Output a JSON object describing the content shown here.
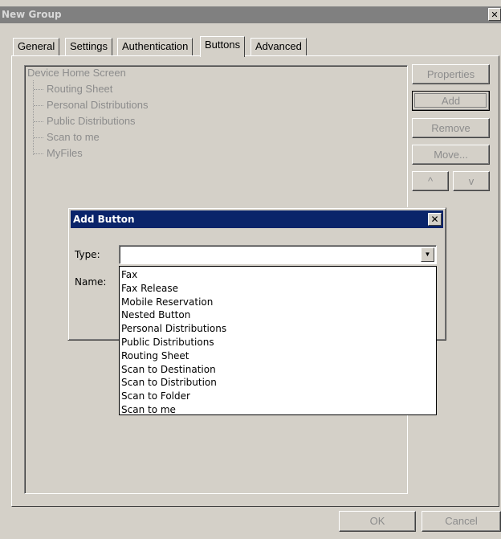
{
  "window": {
    "title": "New Group",
    "close_glyph": "✕"
  },
  "tabs": [
    {
      "label": "General"
    },
    {
      "label": "Settings"
    },
    {
      "label": "Authentication"
    },
    {
      "label": "Buttons",
      "active": true
    },
    {
      "label": "Advanced"
    }
  ],
  "tree": {
    "root": "Device Home Screen",
    "items": [
      "Routing Sheet",
      "Personal Distributions",
      "Public Distributions",
      "Scan to me",
      "MyFiles"
    ]
  },
  "side_buttons": {
    "properties": "Properties",
    "add": "Add",
    "remove": "Remove",
    "move": "Move...",
    "up": "^",
    "down": "v"
  },
  "footer": {
    "ok": "OK",
    "cancel": "Cancel"
  },
  "add_dialog": {
    "title": "Add Button",
    "close_glyph": "✕",
    "type_label": "Type:",
    "name_label": "Name:",
    "type_value": "",
    "type_options": [
      "Fax",
      "Fax Release",
      "Mobile Reservation",
      "Nested Button",
      "Personal Distributions",
      "Public Distributions",
      "Routing Sheet",
      "Scan to Destination",
      "Scan to Distribution",
      "Scan to Folder",
      "Scan to me"
    ]
  },
  "icons": {
    "dropdown_arrow": "chevron-down-icon",
    "close": "close-icon"
  },
  "colors": {
    "dialog_title_bg": "#0a246a",
    "window_title_bg": "#808080",
    "face": "#d4d0c8",
    "disabled_text": "#8c8c8c"
  }
}
